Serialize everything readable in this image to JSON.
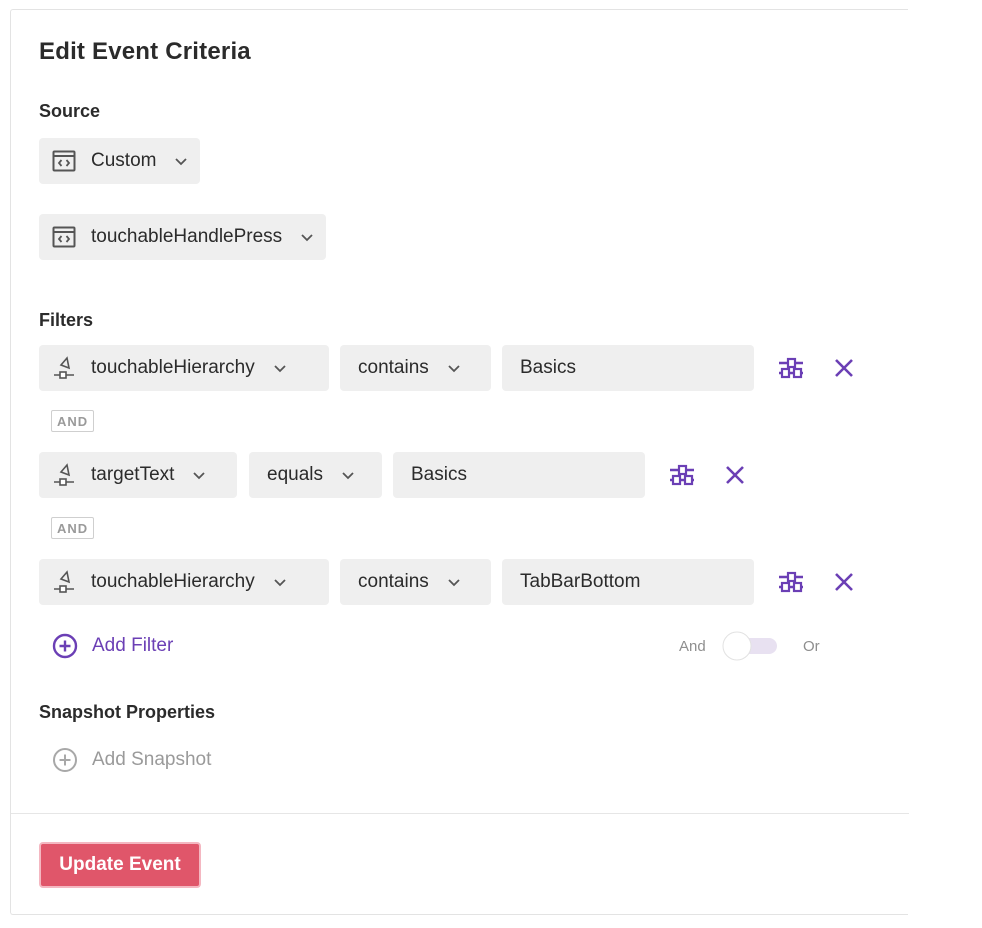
{
  "title": "Edit Event Criteria",
  "source": {
    "label": "Source",
    "type_select": {
      "value": "Custom",
      "icon": "code-window-icon"
    },
    "event_select": {
      "value": "touchableHandlePress",
      "icon": "code-window-icon"
    }
  },
  "filters": {
    "label": "Filters",
    "conjunction": "AND",
    "rows": [
      {
        "property": "touchableHierarchy",
        "operator": "contains",
        "value": "Basics"
      },
      {
        "property": "targetText",
        "operator": "equals",
        "value": "Basics"
      },
      {
        "property": "touchableHierarchy",
        "operator": "contains",
        "value": "TabBarBottom"
      }
    ],
    "add_label": "Add Filter",
    "toggle": {
      "left_label": "And",
      "right_label": "Or",
      "selected": "And"
    }
  },
  "snapshot": {
    "label": "Snapshot Properties",
    "add_label": "Add Snapshot"
  },
  "footer": {
    "update_label": "Update Event"
  },
  "colors": {
    "accent": "#6b3fb5",
    "primary_button": "#e0566a",
    "pill_bg": "#efefef",
    "muted": "#9a9a9a"
  }
}
